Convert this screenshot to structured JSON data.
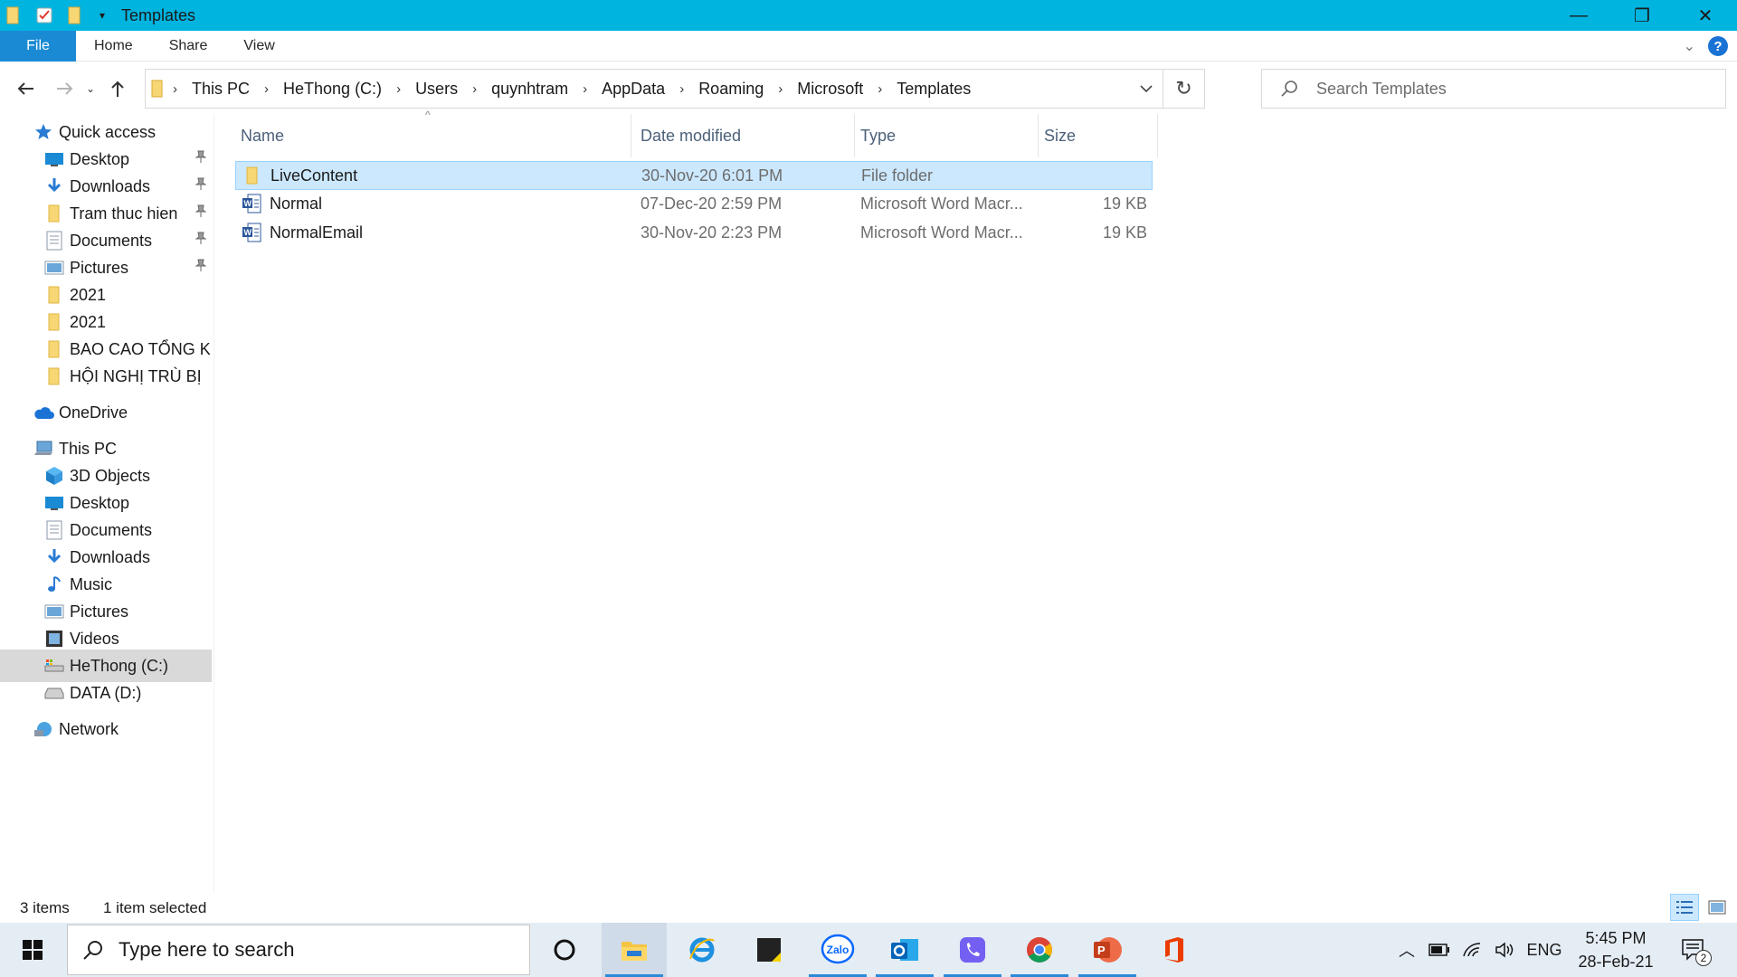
{
  "window": {
    "title": "Templates",
    "minimize_glyph": "—",
    "restore_glyph": "❐",
    "close_glyph": "✕"
  },
  "ribbon": {
    "tabs": [
      "File",
      "Home",
      "Share",
      "View"
    ],
    "help_glyph": "?"
  },
  "address": {
    "crumbs": [
      "This PC",
      "HeThong (C:)",
      "Users",
      "quynhtram",
      "AppData",
      "Roaming",
      "Microsoft",
      "Templates"
    ]
  },
  "search": {
    "placeholder": "Search Templates"
  },
  "nav_pane": {
    "items": [
      {
        "label": "Quick access",
        "icon": "star-icon",
        "pinned": false
      },
      {
        "label": "Desktop",
        "icon": "desktop-icon",
        "pinned": true
      },
      {
        "label": "Downloads",
        "icon": "download-icon",
        "pinned": true
      },
      {
        "label": "Tram thuc hien",
        "icon": "folder-icon",
        "pinned": true
      },
      {
        "label": "Documents",
        "icon": "documents-icon",
        "pinned": true
      },
      {
        "label": "Pictures",
        "icon": "pictures-icon",
        "pinned": true
      },
      {
        "label": "2021",
        "icon": "folder-icon",
        "pinned": false
      },
      {
        "label": "2021",
        "icon": "folder-icon",
        "pinned": false
      },
      {
        "label": "BAO CAO TỔNG KẾ",
        "icon": "folder-icon",
        "pinned": false
      },
      {
        "label": "HỘI NGHỊ TRÙ BỊ",
        "icon": "folder-icon",
        "pinned": false
      },
      {
        "label": "OneDrive",
        "icon": "cloud-icon",
        "pinned": false
      },
      {
        "label": "This PC",
        "icon": "computer-icon",
        "pinned": false
      },
      {
        "label": "3D Objects",
        "icon": "cube-icon",
        "pinned": false
      },
      {
        "label": "Desktop",
        "icon": "desktop-icon",
        "pinned": false
      },
      {
        "label": "Documents",
        "icon": "documents-icon",
        "pinned": false
      },
      {
        "label": "Downloads",
        "icon": "download-icon",
        "pinned": false
      },
      {
        "label": "Music",
        "icon": "music-icon",
        "pinned": false
      },
      {
        "label": "Pictures",
        "icon": "pictures-icon",
        "pinned": false
      },
      {
        "label": "Videos",
        "icon": "videos-icon",
        "pinned": false
      },
      {
        "label": "HeThong (C:)",
        "icon": "drive-c-icon",
        "pinned": false,
        "selected": true
      },
      {
        "label": "DATA (D:)",
        "icon": "drive-icon",
        "pinned": false
      },
      {
        "label": "Network",
        "icon": "network-icon",
        "pinned": false
      }
    ]
  },
  "columns": {
    "name": "Name",
    "date": "Date modified",
    "type": "Type",
    "size": "Size",
    "sorted_by": "Name"
  },
  "files": [
    {
      "name": "LiveContent",
      "date": "30-Nov-20 6:01 PM",
      "type": "File folder",
      "size": "",
      "icon": "folder-icon",
      "selected": true
    },
    {
      "name": "Normal",
      "date": "07-Dec-20 2:59 PM",
      "type": "Microsoft Word Macr...",
      "size": "19 KB",
      "icon": "word-template-icon",
      "selected": false
    },
    {
      "name": "NormalEmail",
      "date": "30-Nov-20 2:23 PM",
      "type": "Microsoft Word Macr...",
      "size": "19 KB",
      "icon": "word-template-icon",
      "selected": false
    }
  ],
  "status": {
    "item_count": "3 items",
    "selection": "1 item selected",
    "view": "details"
  },
  "taskbar": {
    "search_placeholder": "Type here to search",
    "apps": [
      {
        "name": "cortana",
        "icon": "cortana-icon",
        "running": false
      },
      {
        "name": "file-explorer",
        "icon": "file-explorer-icon",
        "running": true,
        "active": true
      },
      {
        "name": "internet-explorer",
        "icon": "internet-explorer-icon",
        "running": false
      },
      {
        "name": "sticky-notes",
        "icon": "sticky-notes-icon",
        "running": false
      },
      {
        "name": "zalo",
        "icon": "zalo-icon",
        "running": true
      },
      {
        "name": "outlook",
        "icon": "outlook-icon",
        "running": true
      },
      {
        "name": "viber",
        "icon": "viber-icon",
        "running": true
      },
      {
        "name": "chrome",
        "icon": "chrome-icon",
        "running": true
      },
      {
        "name": "powerpoint",
        "icon": "powerpoint-icon",
        "running": true
      },
      {
        "name": "office",
        "icon": "office-icon",
        "running": false
      }
    ],
    "zalo_label": "Zalo",
    "language": "ENG",
    "time": "5:45 PM",
    "date": "28-Feb-21",
    "notification_count": "2"
  },
  "colors": {
    "titlebar": "#00b4e0",
    "file_tab": "#1a8ad4",
    "selection_bg": "#cce8ff",
    "selection_border": "#99d1ff",
    "taskbar": "#e4ecf4"
  }
}
